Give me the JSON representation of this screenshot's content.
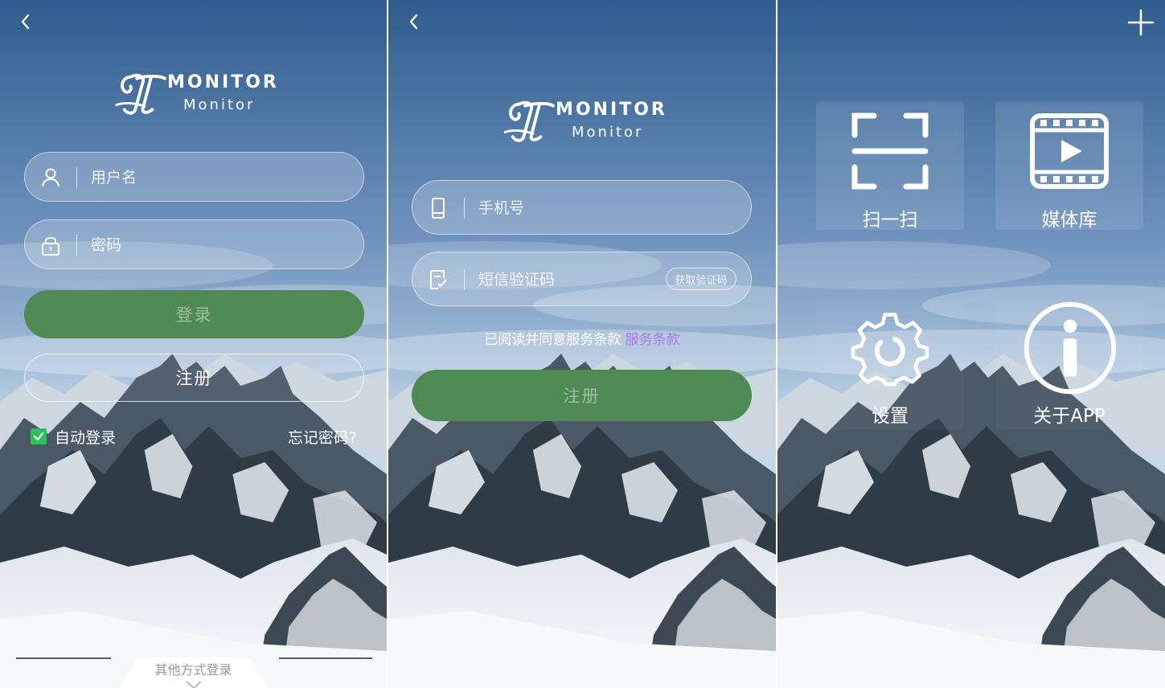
{
  "colors": {
    "sky_top": "#2f5c8e",
    "sky_mid": "#8fb0d0",
    "mountain_dark": "#3a4a55",
    "snow": "#f3f6f8",
    "green_button": "#4f8a55",
    "checkbox_green": "#2fc25b",
    "terms_link": "#a77be8"
  },
  "logo": {
    "wordmark": "MONITOR",
    "subtitle": "Monitor"
  },
  "login": {
    "back_icon": "chevron-left-icon",
    "username_placeholder": "用户名",
    "username_icon": "user-icon",
    "password_placeholder": "密码",
    "password_icon": "lock-icon",
    "login_label": "登录",
    "register_label": "注册",
    "auto_login_label": "自动登录",
    "auto_login_checked": true,
    "forgot_label": "忘记密码?",
    "other_login_label": "其他方式登录"
  },
  "register": {
    "back_icon": "chevron-left-icon",
    "phone_placeholder": "手机号",
    "phone_icon": "phone-icon",
    "sms_placeholder": "短信验证码",
    "sms_icon": "sms-check-icon",
    "get_code_label": "获取验证码",
    "terms_text": "已阅读并同意服务条款 ",
    "terms_link": "服务条款",
    "register_label": "注册"
  },
  "home": {
    "add_icon": "plus-icon",
    "tiles": [
      {
        "label": "扫一扫",
        "icon": "scan-icon"
      },
      {
        "label": "媒体库",
        "icon": "media-library-icon"
      },
      {
        "label": "设置",
        "icon": "gear-icon"
      },
      {
        "label": "关于APP",
        "icon": "info-icon"
      }
    ]
  }
}
